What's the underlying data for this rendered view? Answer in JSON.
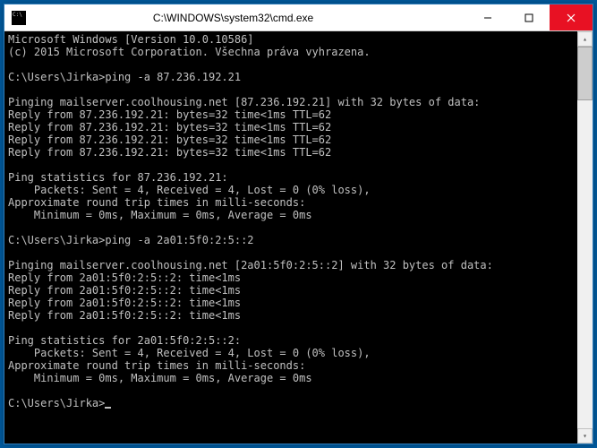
{
  "titlebar": {
    "title": "C:\\WINDOWS\\system32\\cmd.exe"
  },
  "terminal": {
    "lines": [
      "Microsoft Windows [Version 10.0.10586]",
      "(c) 2015 Microsoft Corporation. Všechna práva vyhrazena.",
      "",
      "C:\\Users\\Jirka>ping -a 87.236.192.21",
      "",
      "Pinging mailserver.coolhousing.net [87.236.192.21] with 32 bytes of data:",
      "Reply from 87.236.192.21: bytes=32 time<1ms TTL=62",
      "Reply from 87.236.192.21: bytes=32 time<1ms TTL=62",
      "Reply from 87.236.192.21: bytes=32 time<1ms TTL=62",
      "Reply from 87.236.192.21: bytes=32 time<1ms TTL=62",
      "",
      "Ping statistics for 87.236.192.21:",
      "    Packets: Sent = 4, Received = 4, Lost = 0 (0% loss),",
      "Approximate round trip times in milli-seconds:",
      "    Minimum = 0ms, Maximum = 0ms, Average = 0ms",
      "",
      "C:\\Users\\Jirka>ping -a 2a01:5f0:2:5::2",
      "",
      "Pinging mailserver.coolhousing.net [2a01:5f0:2:5::2] with 32 bytes of data:",
      "Reply from 2a01:5f0:2:5::2: time<1ms",
      "Reply from 2a01:5f0:2:5::2: time<1ms",
      "Reply from 2a01:5f0:2:5::2: time<1ms",
      "Reply from 2a01:5f0:2:5::2: time<1ms",
      "",
      "Ping statistics for 2a01:5f0:2:5::2:",
      "    Packets: Sent = 4, Received = 4, Lost = 0 (0% loss),",
      "Approximate round trip times in milli-seconds:",
      "    Minimum = 0ms, Maximum = 0ms, Average = 0ms",
      "",
      "C:\\Users\\Jirka>"
    ],
    "prompt_final": "C:\\Users\\Jirka>"
  }
}
